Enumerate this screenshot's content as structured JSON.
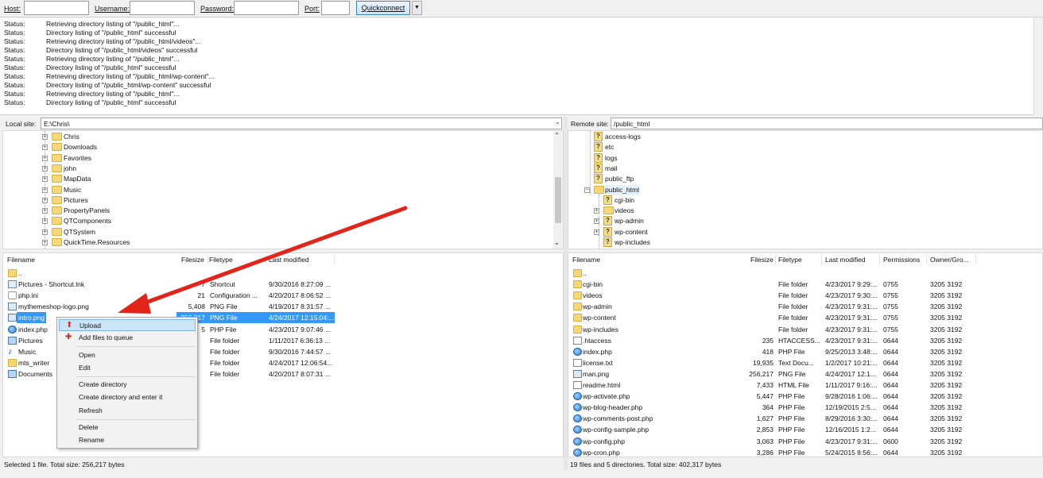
{
  "quickconnect": {
    "host_label": "Host:",
    "username_label": "Username:",
    "password_label": "Password:",
    "port_label": "Port:",
    "button_label": "Quickconnect"
  },
  "log": [
    {
      "key": "Status:",
      "msg": "Retrieving directory listing of \"/public_html\"..."
    },
    {
      "key": "Status:",
      "msg": "Directory listing of \"/public_html\" successful"
    },
    {
      "key": "Status:",
      "msg": "Retrieving directory listing of \"/public_html/videos\"..."
    },
    {
      "key": "Status:",
      "msg": "Directory listing of \"/public_html/videos\" successful"
    },
    {
      "key": "Status:",
      "msg": "Retrieving directory listing of \"/public_html\"..."
    },
    {
      "key": "Status:",
      "msg": "Directory listing of \"/public_html\" successful"
    },
    {
      "key": "Status:",
      "msg": "Retrieving directory listing of \"/public_html/wp-content\"..."
    },
    {
      "key": "Status:",
      "msg": "Directory listing of \"/public_html/wp-content\" successful"
    },
    {
      "key": "Status:",
      "msg": "Retrieving directory listing of \"/public_html\"..."
    },
    {
      "key": "Status:",
      "msg": "Directory listing of \"/public_html\" successful"
    }
  ],
  "local": {
    "site_label": "Local site:",
    "path": "E:\\Chris\\",
    "tree": [
      "Chris",
      "Downloads",
      "Favorites",
      "john",
      "MapData",
      "Music",
      "Pictures",
      "PropertyPanels",
      "QTComponents",
      "QTSystem",
      "QuickTime.Resources"
    ],
    "columns": {
      "filename": "Filename",
      "filesize": "Filesize",
      "filetype": "Filetype",
      "modified": "Last modified"
    },
    "files": [
      {
        "name": "..",
        "size": "",
        "type": "",
        "modified": ""
      },
      {
        "name": "Pictures - Shortcut.lnk",
        "size": "7",
        "type": "Shortcut",
        "modified": "9/30/2016 8:27:09 ..."
      },
      {
        "name": "php.ini",
        "size": "21",
        "type": "Configuration ...",
        "modified": "4/20/2017 8:06:52 ..."
      },
      {
        "name": "mythemeshop-logo.png",
        "size": "5,408",
        "type": "PNG File",
        "modified": "4/19/2017 8:31:57 ..."
      },
      {
        "name": "intro.png",
        "size": "256,217",
        "type": "PNG File",
        "modified": "4/24/2017 12:15:04:..."
      },
      {
        "name": "index.php",
        "size": "5",
        "type": "PHP File",
        "modified": "4/23/2017 9:07:46 ..."
      },
      {
        "name": "Pictures",
        "size": "",
        "type": "File folder",
        "modified": "1/11/2017 6:36:13 ..."
      },
      {
        "name": "Music",
        "size": "",
        "type": "File folder",
        "modified": "9/30/2016 7:44:57 ..."
      },
      {
        "name": "mts_writer",
        "size": "",
        "type": "File folder",
        "modified": "4/24/2017 12:06:54..."
      },
      {
        "name": "Documents",
        "size": "",
        "type": "File folder",
        "modified": "4/20/2017 8:07:31 ..."
      }
    ],
    "status": "Selected 1 file. Total size: 256,217 bytes"
  },
  "remote": {
    "site_label": "Remote site:",
    "path": "/public_html",
    "tree": [
      "access-logs",
      "etc",
      "logs",
      "mail",
      "public_ftp",
      "public_html",
      "cgi-bin",
      "videos",
      "wp-admin",
      "wp-content",
      "wp-includes"
    ],
    "columns": {
      "filename": "Filename",
      "filesize": "Filesize",
      "filetype": "Filetype",
      "modified": "Last modified",
      "permissions": "Permissions",
      "owner": "Owner/Gro..."
    },
    "files": [
      {
        "name": "..",
        "size": "",
        "type": "",
        "modified": "",
        "perm": "",
        "owner": ""
      },
      {
        "name": "cgi-bin",
        "size": "",
        "type": "File folder",
        "modified": "4/23/2017 9:29:...",
        "perm": "0755",
        "owner": "3205 3192"
      },
      {
        "name": "videos",
        "size": "",
        "type": "File folder",
        "modified": "4/23/2017 9:30:...",
        "perm": "0755",
        "owner": "3205 3192"
      },
      {
        "name": "wp-admin",
        "size": "",
        "type": "File folder",
        "modified": "4/23/2017 9:31:...",
        "perm": "0755",
        "owner": "3205 3192"
      },
      {
        "name": "wp-content",
        "size": "",
        "type": "File folder",
        "modified": "4/23/2017 9:31:...",
        "perm": "0755",
        "owner": "3205 3192"
      },
      {
        "name": "wp-includes",
        "size": "",
        "type": "File folder",
        "modified": "4/23/2017 9:31:...",
        "perm": "0755",
        "owner": "3205 3192"
      },
      {
        "name": ".htaccess",
        "size": "235",
        "type": "HTACCESS...",
        "modified": "4/23/2017 9:31:...",
        "perm": "0644",
        "owner": "3205 3192"
      },
      {
        "name": "index.php",
        "size": "418",
        "type": "PHP File",
        "modified": "9/25/2013 3:48:...",
        "perm": "0644",
        "owner": "3205 3192"
      },
      {
        "name": "license.txt",
        "size": "19,935",
        "type": "Text Docu...",
        "modified": "1/2/2017 10:21:...",
        "perm": "0644",
        "owner": "3205 3192"
      },
      {
        "name": "man.png",
        "size": "256,217",
        "type": "PNG File",
        "modified": "4/24/2017 12:1...",
        "perm": "0644",
        "owner": "3205 3192"
      },
      {
        "name": "readme.html",
        "size": "7,433",
        "type": "HTML File",
        "modified": "1/11/2017 9:16:...",
        "perm": "0644",
        "owner": "3205 3192"
      },
      {
        "name": "wp-activate.php",
        "size": "5,447",
        "type": "PHP File",
        "modified": "9/28/2016 1:06:...",
        "perm": "0644",
        "owner": "3205 3192"
      },
      {
        "name": "wp-blog-header.php",
        "size": "364",
        "type": "PHP File",
        "modified": "12/19/2015 2:5...",
        "perm": "0644",
        "owner": "3205 3192"
      },
      {
        "name": "wp-comments-post.php",
        "size": "1,627",
        "type": "PHP File",
        "modified": "8/29/2016 3:30:...",
        "perm": "0644",
        "owner": "3205 3192"
      },
      {
        "name": "wp-config-sample.php",
        "size": "2,853",
        "type": "PHP File",
        "modified": "12/16/2015 1:2...",
        "perm": "0644",
        "owner": "3205 3192"
      },
      {
        "name": "wp-config.php",
        "size": "3,063",
        "type": "PHP File",
        "modified": "4/23/2017 9:31:...",
        "perm": "0600",
        "owner": "3205 3192"
      },
      {
        "name": "wp-cron.php",
        "size": "3,286",
        "type": "PHP File",
        "modified": "5/24/2015 8:56:...",
        "perm": "0644",
        "owner": "3205 3192"
      }
    ],
    "status": "19 files and 5 directories. Total size: 402,317 bytes"
  },
  "context_menu": {
    "upload": "Upload",
    "add_to_queue": "Add files to queue",
    "open": "Open",
    "edit": "Edit",
    "create_dir": "Create directory",
    "create_dir_enter": "Create directory and enter it",
    "refresh": "Refresh",
    "delete": "Delete",
    "rename": "Rename"
  },
  "colors": {
    "selection": "#3399ff",
    "annotation_arrow": "#e3241b",
    "folder": "#f8d775"
  }
}
